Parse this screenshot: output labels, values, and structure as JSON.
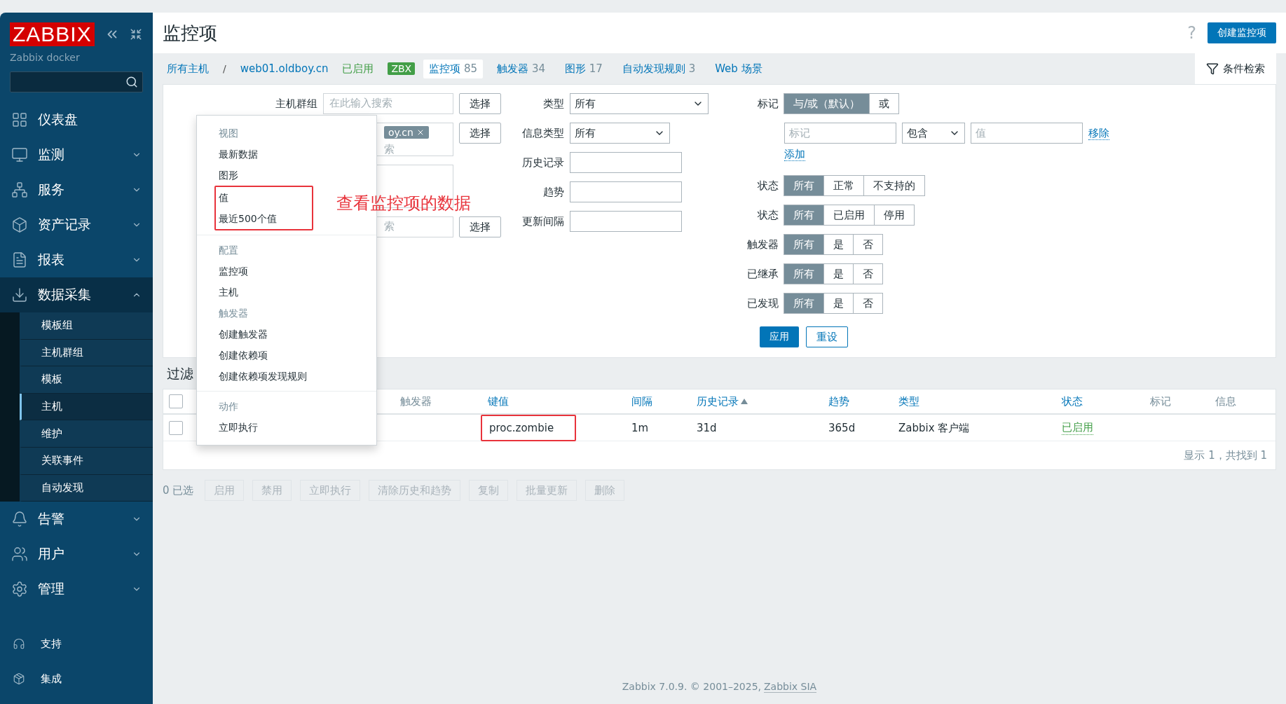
{
  "sidebar": {
    "logo": "ZABBIX",
    "server": "Zabbix docker",
    "items": [
      {
        "label": "仪表盘",
        "kind": "link",
        "selected": false
      },
      {
        "label": "监测",
        "kind": "menu",
        "expanded": false,
        "selected": false
      },
      {
        "label": "服务",
        "kind": "menu",
        "expanded": false,
        "selected": false
      },
      {
        "label": "资产记录",
        "kind": "menu",
        "expanded": false,
        "selected": false
      },
      {
        "label": "报表",
        "kind": "menu",
        "expanded": false,
        "selected": false
      },
      {
        "label": "数据采集",
        "kind": "menu",
        "expanded": true,
        "selected": true,
        "children": [
          {
            "label": "模板组",
            "selected": false
          },
          {
            "label": "主机群组",
            "selected": false
          },
          {
            "label": "模板",
            "selected": false
          },
          {
            "label": "主机",
            "selected": true
          },
          {
            "label": "维护",
            "selected": false
          },
          {
            "label": "关联事件",
            "selected": false
          },
          {
            "label": "自动发现",
            "selected": false
          }
        ]
      },
      {
        "label": "告警",
        "kind": "menu",
        "expanded": false,
        "selected": false
      },
      {
        "label": "用户",
        "kind": "menu",
        "expanded": false,
        "selected": false
      },
      {
        "label": "管理",
        "kind": "menu",
        "expanded": false,
        "selected": false
      }
    ],
    "footer_items": [
      {
        "label": "支持"
      },
      {
        "label": "集成"
      }
    ]
  },
  "header": {
    "title": "监控项",
    "help": "?",
    "create_button": "创建监控项"
  },
  "nav": {
    "breadcrumb": [
      "所有主机",
      "web01.oldboy.cn"
    ],
    "separator": "/",
    "status": "已启用",
    "badge": "ZBX",
    "tabs": [
      {
        "label": "监控项",
        "count": "85",
        "selected": true
      },
      {
        "label": "触发器",
        "count": "34",
        "selected": false
      },
      {
        "label": "图形",
        "count": "17",
        "selected": false
      },
      {
        "label": "自动发现规则",
        "count": "3",
        "selected": false
      },
      {
        "label": "Web 场景",
        "selected": false
      }
    ],
    "filter_tab": "条件检索"
  },
  "filter": {
    "left": [
      {
        "label": "主机群组",
        "placeholder": "在此输入搜索",
        "button": "选择"
      },
      {
        "chip": "oy.cn",
        "placeholder": "索",
        "button": "选择"
      },
      {
        "kind": "area"
      },
      {
        "placeholder": "索",
        "button": "选择"
      }
    ],
    "middle": [
      {
        "label": "类型",
        "select": "所有",
        "kind": "wide"
      },
      {
        "label": "信息类型",
        "select": "所有",
        "kind": "narrow"
      },
      {
        "label": "历史记录"
      },
      {
        "label": "趋势"
      },
      {
        "label": "更新间隔"
      }
    ],
    "tags": {
      "label": "标记",
      "options": [
        {
          "label": "与/或（默认）",
          "selected": true
        },
        {
          "label": "或",
          "selected": false
        }
      ],
      "rows": [
        {
          "tag_placeholder": "标记",
          "operator": "包含",
          "value_placeholder": "值",
          "remove": "移除"
        }
      ],
      "add": "添加"
    },
    "groups": [
      {
        "label": "状态",
        "options": [
          {
            "label": "所有",
            "selected": true
          },
          {
            "label": "正常",
            "selected": false
          },
          {
            "label": "不支持的",
            "selected": false
          }
        ]
      },
      {
        "label": "状态",
        "options": [
          {
            "label": "所有",
            "selected": true
          },
          {
            "label": "已启用",
            "selected": false
          },
          {
            "label": "停用",
            "selected": false
          }
        ]
      },
      {
        "label": "触发器",
        "options": [
          {
            "label": "所有",
            "selected": true
          },
          {
            "label": "是",
            "selected": false
          },
          {
            "label": "否",
            "selected": false
          }
        ]
      },
      {
        "label": "已继承",
        "options": [
          {
            "label": "所有",
            "selected": true
          },
          {
            "label": "是",
            "selected": false
          },
          {
            "label": "否",
            "selected": false
          }
        ]
      },
      {
        "label": "已发现",
        "options": [
          {
            "label": "所有",
            "selected": true
          },
          {
            "label": "是",
            "selected": false
          },
          {
            "label": "否",
            "selected": false
          }
        ]
      }
    ],
    "apply": "应用",
    "reset": "重设"
  },
  "filter_title": "过滤",
  "table": {
    "columns": [
      {
        "kind": "check",
        "checked": false
      },
      {
        "kind": "blank"
      },
      {
        "label": "触发器",
        "kind": "plain"
      },
      {
        "label": "键值",
        "kind": "link"
      },
      {
        "label": "间隔",
        "kind": "link"
      },
      {
        "label": "历史记录",
        "kind": "link",
        "sorted": true
      },
      {
        "label": "趋势",
        "kind": "link"
      },
      {
        "label": "类型",
        "kind": "link"
      },
      {
        "label": "状态",
        "kind": "link"
      },
      {
        "label": "标记",
        "kind": "plain"
      },
      {
        "label": "信息",
        "kind": "plain"
      }
    ],
    "rows": [
      {
        "checked": false,
        "key": "proc.zombie",
        "key_highlighted": true,
        "interval": "1m",
        "history": "31d",
        "trends": "365d",
        "type": "Zabbix 客户端",
        "status": "已启用"
      }
    ],
    "summary": "显示 1，共找到 1"
  },
  "actions": {
    "selected": "0 已选",
    "buttons": [
      {
        "label": "启用",
        "disabled": true
      },
      {
        "label": "禁用",
        "disabled": true
      },
      {
        "label": "立即执行",
        "disabled": true
      },
      {
        "label": "清除历史和趋势",
        "disabled": true
      },
      {
        "label": "复制",
        "disabled": true
      },
      {
        "label": "批量更新",
        "disabled": true
      },
      {
        "label": "删除",
        "disabled": true
      }
    ]
  },
  "context_menu": {
    "sections": [
      {
        "entries": [
          {
            "kind": "header",
            "label": "视图"
          },
          {
            "kind": "item",
            "label": "最新数据",
            "highlighted": false
          },
          {
            "kind": "item",
            "label": "图形",
            "highlighted": false
          },
          {
            "kind": "item",
            "label": "值",
            "highlighted": true
          },
          {
            "kind": "item",
            "label": "最近500个值",
            "highlighted": true
          }
        ]
      },
      {
        "entries": [
          {
            "kind": "header",
            "label": "配置"
          },
          {
            "kind": "item",
            "label": "监控项",
            "highlighted": false
          },
          {
            "kind": "item",
            "label": "主机",
            "highlighted": false
          },
          {
            "kind": "header",
            "label": "触发器"
          },
          {
            "kind": "item",
            "label": "创建触发器",
            "highlighted": false
          },
          {
            "kind": "item",
            "label": "创建依赖项",
            "highlighted": false
          },
          {
            "kind": "item",
            "label": "创建依赖项发现规则",
            "highlighted": false
          }
        ]
      },
      {
        "entries": [
          {
            "kind": "header",
            "label": "动作"
          },
          {
            "kind": "item",
            "label": "立即执行",
            "highlighted": false
          }
        ]
      }
    ]
  },
  "annotation": "查看监控项的数据",
  "footer": {
    "text": "Zabbix 7.0.9. © 2001–2025, ",
    "link": "Zabbix SIA"
  }
}
